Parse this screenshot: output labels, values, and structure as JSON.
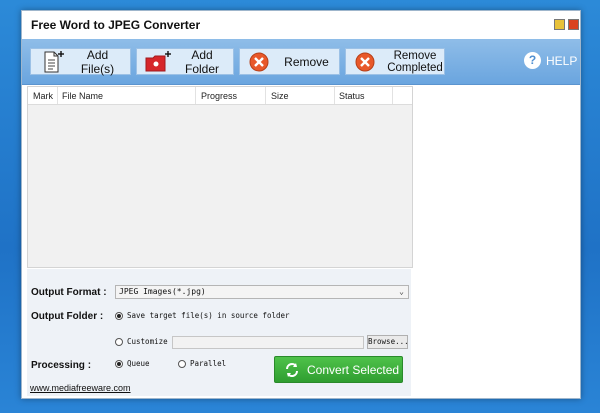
{
  "window": {
    "title": "Free Word to JPEG Converter"
  },
  "toolbar": {
    "add_files": "Add File(s)",
    "add_folder": "Add Folder",
    "remove": "Remove",
    "remove_completed_line1": "Remove",
    "remove_completed_line2": "Completed",
    "help": "HELP"
  },
  "file_list": {
    "columns": [
      "Mark",
      "File Name",
      "Progress",
      "Size",
      "Status"
    ],
    "rows": []
  },
  "options": {
    "output_format_label": "Output Format :",
    "output_format_value": "JPEG Images(*.jpg)",
    "output_folder_label": "Output Folder :",
    "save_target_option": "Save target file(s) in source folder",
    "customize_option": "Customize",
    "custom_path_value": "",
    "browse_label": "Browse...",
    "processing_label": "Processing :",
    "queue_option": "Queue",
    "parallel_option": "Parallel",
    "convert_label": "Convert Selected",
    "website_link": "www.mediafreeware.com"
  },
  "colors": {
    "toolbar_bg": "#7fb3e5",
    "convert_green": "#3aae3a",
    "remove_orange": "#e8582a",
    "folder_red": "#d6262b"
  },
  "icons": {
    "add_files": "document-plus-icon",
    "add_folder": "folder-plus-icon",
    "remove": "remove-x-icon",
    "remove_completed": "remove-x-icon",
    "help": "help-question-icon",
    "convert": "refresh-arrows-icon"
  }
}
